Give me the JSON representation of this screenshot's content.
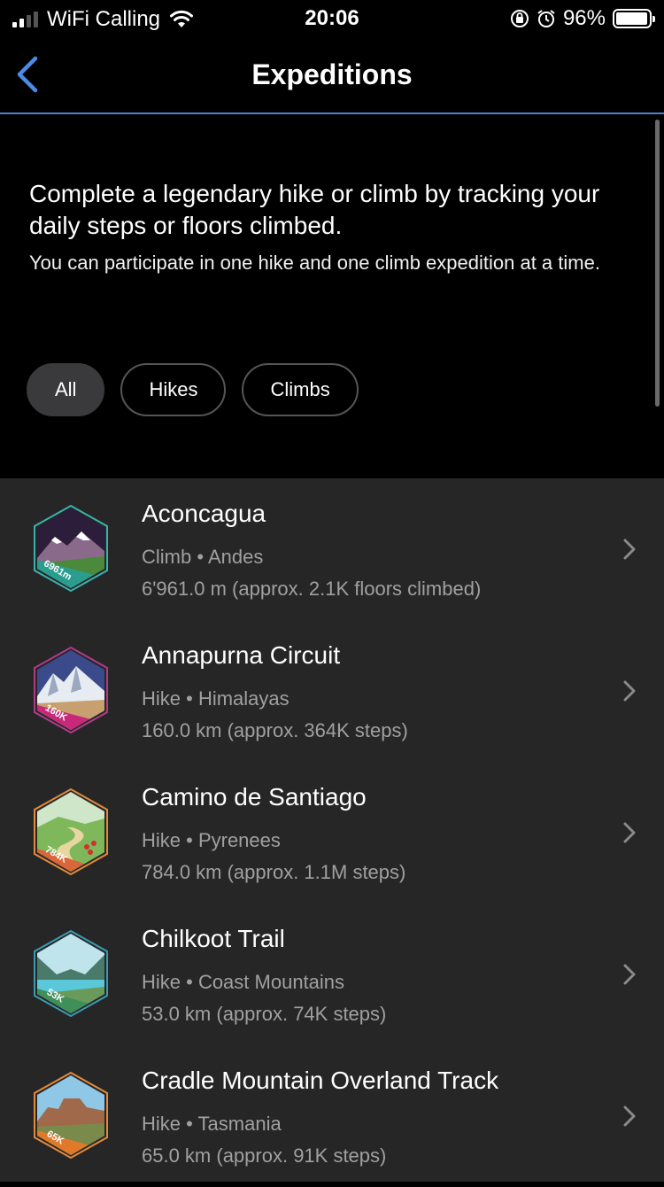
{
  "status_bar": {
    "carrier": "WiFi Calling",
    "time": "20:06",
    "battery_percent": "96%",
    "battery_level": 0.96
  },
  "nav": {
    "title": "Expeditions"
  },
  "intro": {
    "main_text": "Complete a legendary hike or climb by tracking your daily steps or floors climbed.",
    "sub_text": "You can participate in one hike and one climb expedition at a time."
  },
  "filters": [
    {
      "label": "All",
      "active": true
    },
    {
      "label": "Hikes",
      "active": false
    },
    {
      "label": "Climbs",
      "active": false
    }
  ],
  "expeditions": [
    {
      "title": "Aconcagua",
      "meta": "Climb • Andes",
      "detail": "6'961.0 m (approx. 2.1K floors climbed)",
      "badge_label": "6961m",
      "badge_color": "#2a9d8f",
      "badge_border": "#3bb0b0"
    },
    {
      "title": "Annapurna Circuit",
      "meta": "Hike • Himalayas",
      "detail": "160.0 km (approx. 364K steps)",
      "badge_label": "160K",
      "badge_color": "#c8287a",
      "badge_border": "#b03a8a"
    },
    {
      "title": "Camino de Santiago",
      "meta": "Hike • Pyrenees",
      "detail": "784.0 km (approx. 1.1M steps)",
      "badge_label": "784K",
      "badge_color": "#d9673a",
      "badge_border": "#e08a3c"
    },
    {
      "title": "Chilkoot Trail",
      "meta": "Hike • Coast Mountains",
      "detail": "53.0 km (approx. 74K steps)",
      "badge_label": "53K",
      "badge_color": "#3f8f5a",
      "badge_border": "#3a9ab0"
    },
    {
      "title": "Cradle Mountain Overland Track",
      "meta": "Hike • Tasmania",
      "detail": "65.0 km (approx. 91K steps)",
      "badge_label": "65K",
      "badge_color": "#e07a2a",
      "badge_border": "#e08a3c"
    }
  ]
}
